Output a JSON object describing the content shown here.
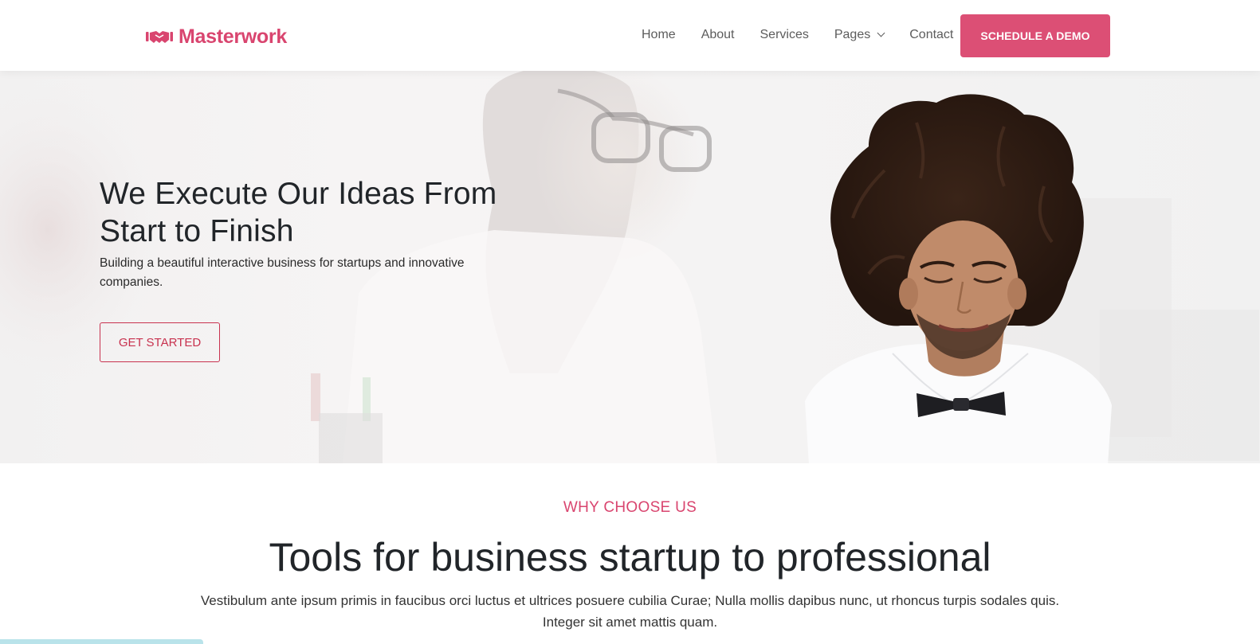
{
  "brand": {
    "name": "Masterwork",
    "color": "#d9456f",
    "icon": "handshake-icon"
  },
  "nav": {
    "items": [
      {
        "label": "Home"
      },
      {
        "label": "About"
      },
      {
        "label": "Services"
      },
      {
        "label": "Pages",
        "has_dropdown": true
      },
      {
        "label": "Contact"
      }
    ],
    "cta_label": "SCHEDULE A DEMO"
  },
  "hero": {
    "title": "We Execute Our Ideas From Start to Finish",
    "subtitle": "Building a beautiful interactive business for startups and innovative companies.",
    "button_label": "GET STARTED"
  },
  "features": {
    "eyebrow": "WHY CHOOSE US",
    "title": "Tools for business startup to professional",
    "text": "Vestibulum ante ipsum primis in faucibus orci luctus et ultrices posuere cubilia Curae; Nulla mollis dapibus nunc, ut rhoncus turpis sodales quis. Integer sit amet mattis quam."
  },
  "colors": {
    "accent": "#dc4f75",
    "outline": "#c8324f",
    "text": "#212529"
  }
}
